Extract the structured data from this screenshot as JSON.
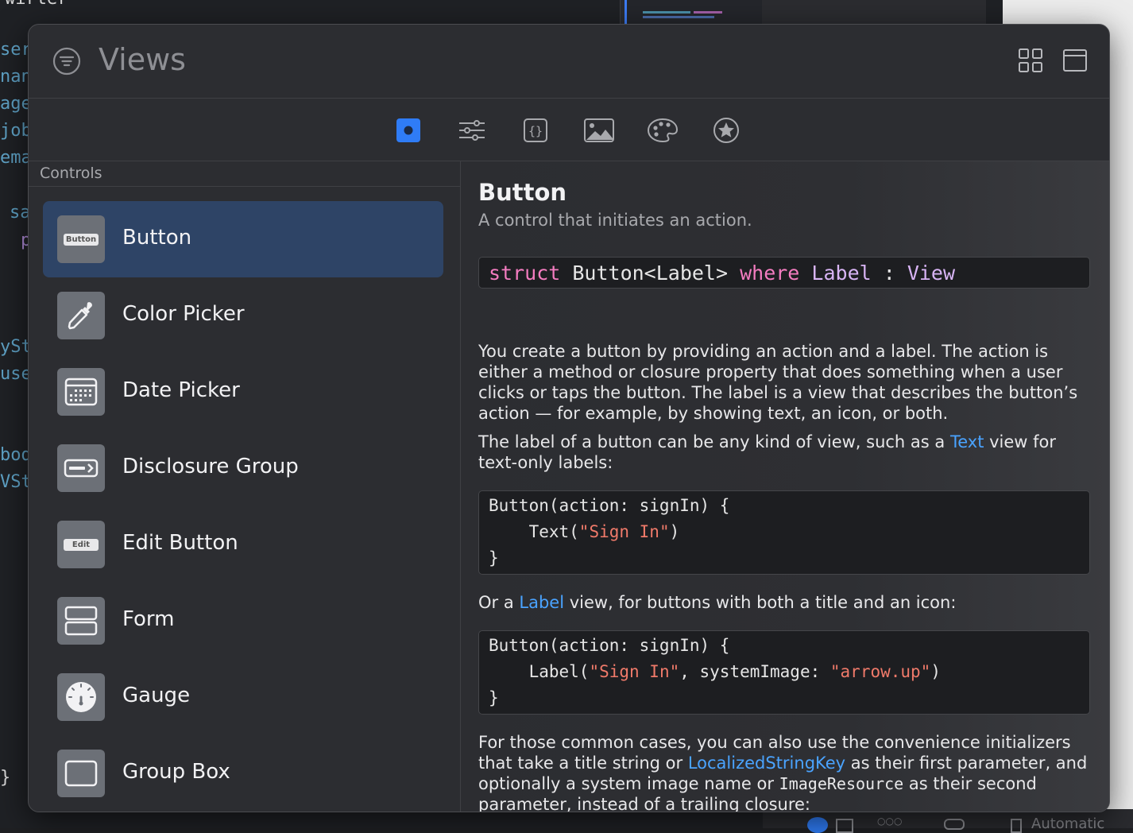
{
  "popover": {
    "title": "Views",
    "section_header": "Controls",
    "tabs": [
      {
        "icon": "views-tab-icon",
        "selected": true
      },
      {
        "icon": "modifiers-tab-icon"
      },
      {
        "icon": "snippets-tab-icon"
      },
      {
        "icon": "image-tab-icon"
      },
      {
        "icon": "color-palette-tab-icon"
      },
      {
        "icon": "favorites-star-icon"
      }
    ],
    "items": [
      {
        "label": "Button",
        "badge": "Button",
        "icon": "button-thumb-icon",
        "selected": true
      },
      {
        "label": "Color Picker",
        "icon": "eyedropper-icon"
      },
      {
        "label": "Date Picker",
        "icon": "calendar-icon"
      },
      {
        "label": "Disclosure Group",
        "icon": "disclosure-icon"
      },
      {
        "label": "Edit Button",
        "badge": "Edit",
        "icon": "edit-thumb-icon"
      },
      {
        "label": "Form",
        "icon": "form-icon"
      },
      {
        "label": "Gauge",
        "icon": "gauge-icon"
      },
      {
        "label": "Group Box",
        "icon": "group-box-icon"
      }
    ]
  },
  "detail": {
    "title": "Button",
    "subtitle": "A control that initiates an action.",
    "decl": {
      "kw_struct": "struct",
      "name": " Button<Label> ",
      "kw_where": "where",
      "ty_label": " Label",
      "colon": " : ",
      "ty_view": "View"
    },
    "p1": "You create a button by providing an action and a label. The action is either a method or closure property that does something when a user clicks or taps the button. The label is a view that describes the button’s action — for example, by showing text, an icon, or both.",
    "p2_a": "The label of a button can be any kind of view, such as a ",
    "p2_link": "Text",
    "p2_b": " view for text-only labels:",
    "code1": {
      "l1": "Button(action: signIn) {",
      "l2_a": "    Text(",
      "l2_str": "\"Sign In\"",
      "l2_b": ")",
      "l3": "}"
    },
    "p3_a": "Or a ",
    "p3_link": "Label",
    "p3_b": " view, for buttons with both a title and an icon:",
    "code2": {
      "l1": "Button(action: signIn) {",
      "l2_a": "    Label(",
      "l2_str1": "\"Sign In\"",
      "l2_b": ", systemImage: ",
      "l2_str2": "\"arrow.up\"",
      "l2_c": ")",
      "l3": "}"
    },
    "p4_a": "For those common cases, you can also use the convenience initializers that take a title string or ",
    "p4_link": "LocalizedStringKey",
    "p4_b": " as their first parameter, and optionally a system image name or ",
    "p4_mono": "ImageResource",
    "p4_c": " as their second parameter, instead of a trailing closure:"
  },
  "background": {
    "code_fragments": [
      "wirter",
      "ser",
      "nan",
      "age",
      "job",
      "ema",
      "sa",
      "p",
      "ySt",
      "use",
      "bod",
      "VSt",
      "}"
    ],
    "status_text": "Automatic"
  },
  "colors": {
    "accent": "#2f7cf6",
    "link": "#4aa3ff",
    "keyword": "#f47cc0",
    "type": "#d8b4f5",
    "string": "#f07a6a",
    "selected_row": "#2e4466"
  }
}
